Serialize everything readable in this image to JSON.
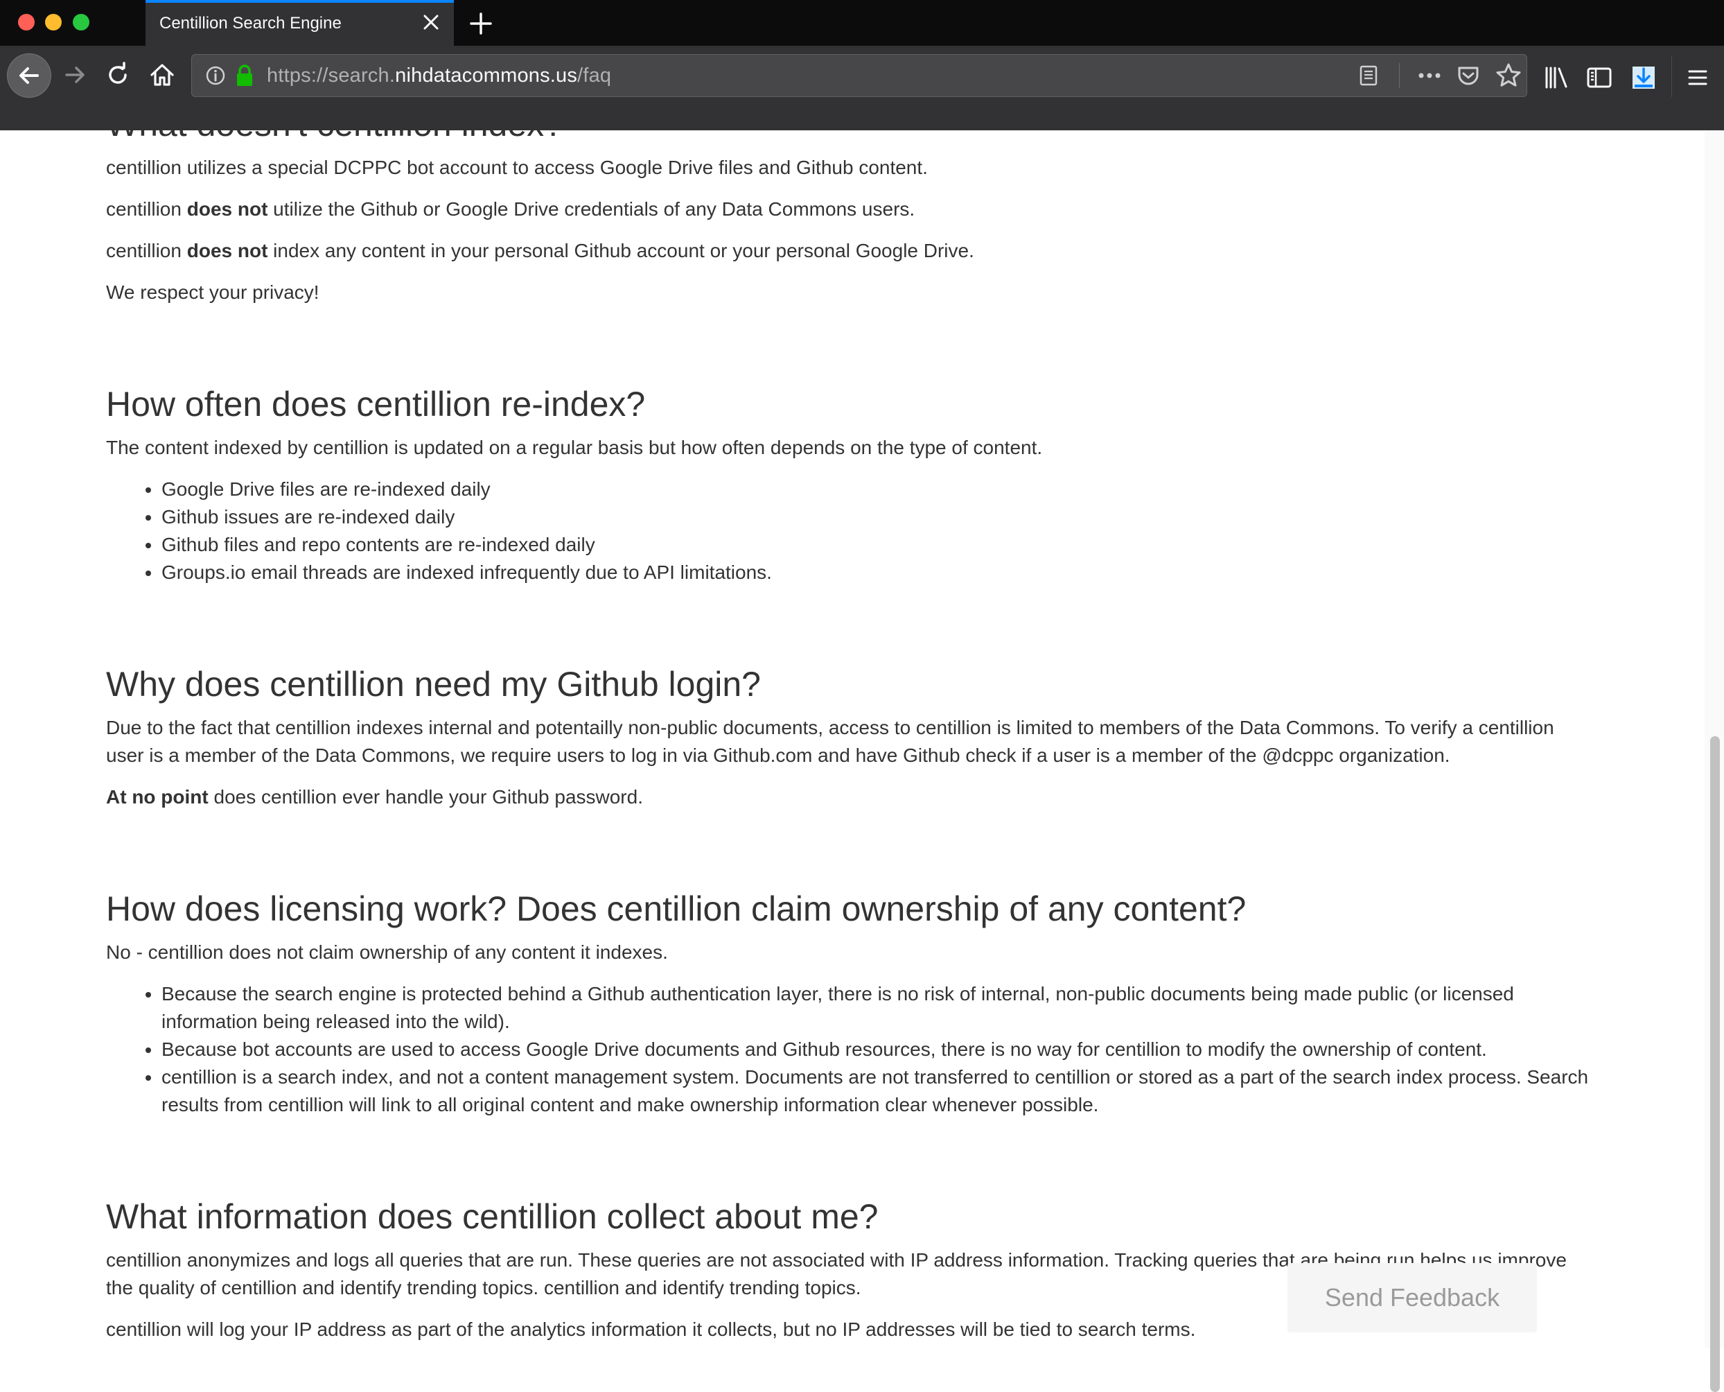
{
  "browser": {
    "tab_title": "Centillion Search Engine",
    "url": {
      "prefix": "https://search.",
      "domain": "nihdatacommons.us",
      "path": "/faq"
    }
  },
  "page": {
    "sections": [
      {
        "heading": "What doesn't centillion index?",
        "paragraphs": [
          {
            "before": "centillion utilizes a special DCPPC bot account to access Google Drive files and Github content.",
            "bold": "",
            "after": ""
          },
          {
            "before": "centillion ",
            "bold": "does not",
            "after": " utilize the Github or Google Drive credentials of any Data Commons users."
          },
          {
            "before": "centillion ",
            "bold": "does not",
            "after": " index any content in your personal Github account or your personal Google Drive."
          },
          {
            "before": "We respect your privacy!",
            "bold": "",
            "after": ""
          }
        ]
      },
      {
        "heading": "How often does centillion re-index?",
        "intro": "The content indexed by centillion is updated on a regular basis but how often depends on the type of content.",
        "bullets": [
          "Google Drive files are re-indexed daily",
          "Github issues are re-indexed daily",
          "Github files and repo contents are re-indexed daily",
          "Groups.io email threads are indexed infrequently due to API limitations."
        ]
      },
      {
        "heading": "Why does centillion need my Github login?",
        "para1": "Due to the fact that centillion indexes internal and potentailly non-public documents, access to centillion is limited to members of the Data Commons. To verify a centillion user is a member of the Data Commons, we require users to log in via Github.com and have Github check if a user is a member of the @dcppc organization.",
        "para2_bold": "At no point",
        "para2_rest": " does centillion ever handle your Github password."
      },
      {
        "heading": "How does licensing work? Does centillion claim ownership of any content?",
        "intro": "No - centillion does not claim ownership of any content it indexes.",
        "bullets": [
          "Because the search engine is protected behind a Github authentication layer, there is no risk of internal, non-public documents being made public (or licensed information being released into the wild).",
          "Because bot accounts are used to access Google Drive documents and Github resources, there is no way for centillion to modify the ownership of content.",
          "centillion is a search index, and not a content management system. Documents are not transferred to centillion or stored as a part of the search index process. Search results from centillion will link to all original content and make ownership information clear whenever possible."
        ]
      },
      {
        "heading": "What information does centillion collect about me?",
        "para1": "centillion anonymizes and logs all queries that are run. These queries are not associated with IP address information. Tracking queries that are being run helps us improve the quality of centillion and identify trending topics. centillion and identify trending topics.",
        "para2": "centillion will log your IP address as part of the analytics information it collects, but no IP addresses will be tied to search terms."
      }
    ]
  },
  "feedback_button": "Send Feedback",
  "icons": {
    "back": "back-arrow-icon",
    "forward": "forward-arrow-icon",
    "reload": "reload-icon",
    "home": "home-icon",
    "info": "info-icon",
    "lock": "lock-icon",
    "reader": "reader-view-icon",
    "more": "more-dots-icon",
    "pocket": "pocket-icon",
    "star": "bookmark-star-icon",
    "library": "library-icon",
    "sidebar": "sidebar-icon",
    "download": "download-icon",
    "menu": "hamburger-menu-icon"
  },
  "colors": {
    "tab_accent": "#0a84ff",
    "lock_green": "#12bc00",
    "text": "#333333"
  }
}
